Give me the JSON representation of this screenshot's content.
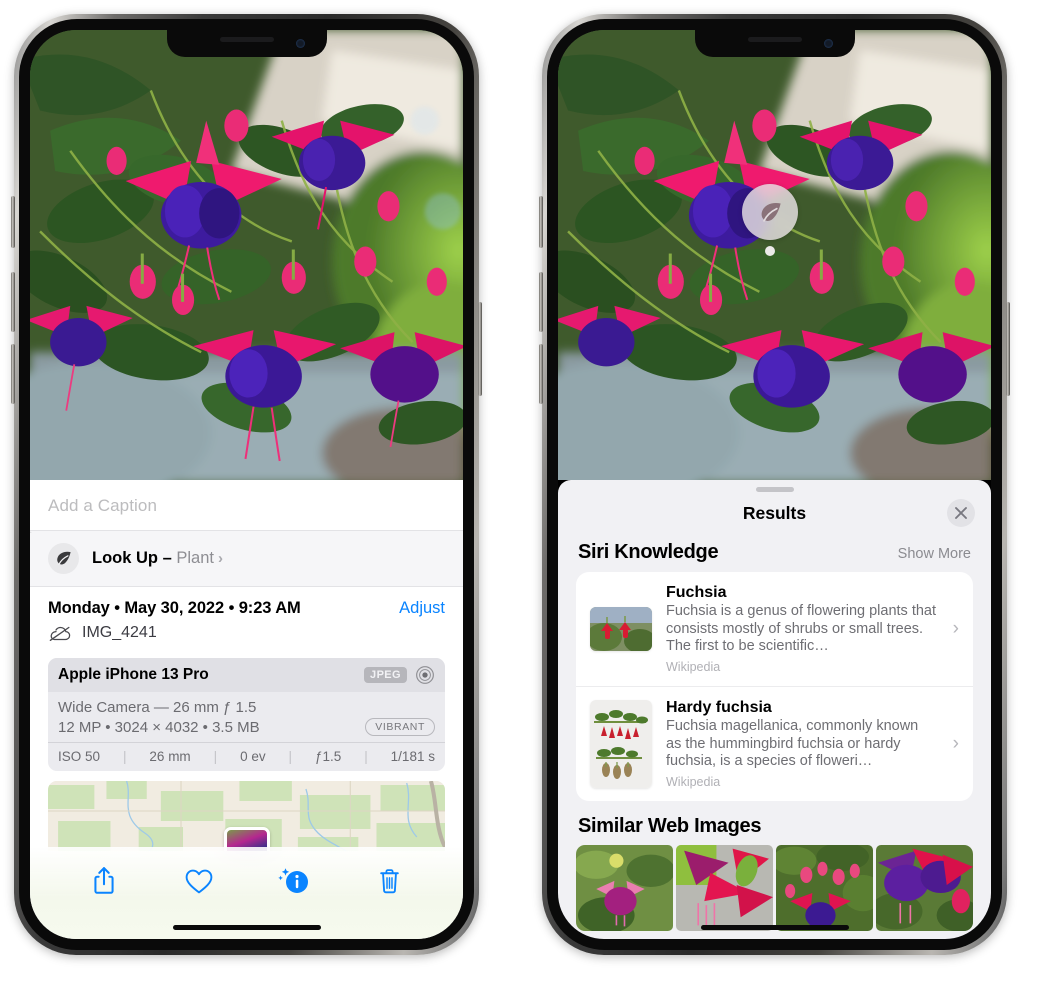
{
  "left_phone": {
    "name": "photo-detail-screen",
    "caption_field": {
      "placeholder": "Add a Caption",
      "value": ""
    },
    "lookup": {
      "icon": "leaf-icon",
      "label": "Look Up",
      "dash": " – ",
      "subject": "Plant",
      "chevron": "›"
    },
    "meta": {
      "date": "Monday • May 30, 2022 • 9:23 AM",
      "adjust_label": "Adjust",
      "cloud_icon": "icloud-slash-icon",
      "filename": "IMG_4241"
    },
    "exif": {
      "device": "Apple iPhone 13 Pro",
      "format_badge": "JPEG",
      "lens_icon": "aperture-icon",
      "lens_line": "Wide Camera — 26 mm ƒ 1.5",
      "resolution_line": "12 MP • 3024 × 4032 • 3.5 MB",
      "profile_badge": "VIBRANT",
      "settings": [
        {
          "label": "ISO 50"
        },
        {
          "label": "26 mm"
        },
        {
          "label": "0 ev"
        },
        {
          "label": "ƒ1.5"
        },
        {
          "label": "1/181 s"
        }
      ],
      "separator": "|"
    },
    "map": {
      "name": "location-map",
      "pin": "photo-pin"
    },
    "toolbar": [
      {
        "name": "share-button",
        "icon": "share-icon"
      },
      {
        "name": "favorite-button",
        "icon": "heart-icon"
      },
      {
        "name": "info-button",
        "icon": "info-sparkle-icon"
      },
      {
        "name": "delete-button",
        "icon": "trash-icon"
      }
    ],
    "accent_color": "#0a84ff"
  },
  "right_phone": {
    "name": "visual-lookup-results-screen",
    "photo_badge": {
      "icon": "leaf-icon",
      "name": "visual-lookup-leaf-pin"
    },
    "sheet": {
      "title": "Results",
      "close_label": "✕",
      "sections": [
        {
          "title": "Siri Knowledge",
          "action": "Show More",
          "items": [
            {
              "title": "Fuchsia",
              "description": "Fuchsia is a genus of flowering plants that consists mostly of shrubs or small trees. The first to be scientific…",
              "source": "Wikipedia",
              "chevron": "›"
            },
            {
              "title": "Hardy fuchsia",
              "description": "Fuchsia magellanica, commonly known as the hummingbird fuchsia or hardy fuchsia, is a species of floweri…",
              "source": "Wikipedia",
              "chevron": "›"
            }
          ]
        },
        {
          "title": "Similar Web Images",
          "action": "",
          "thumbnails": [
            {
              "name": "web-image-1"
            },
            {
              "name": "web-image-2"
            },
            {
              "name": "web-image-3"
            },
            {
              "name": "web-image-4"
            }
          ]
        }
      ]
    }
  }
}
